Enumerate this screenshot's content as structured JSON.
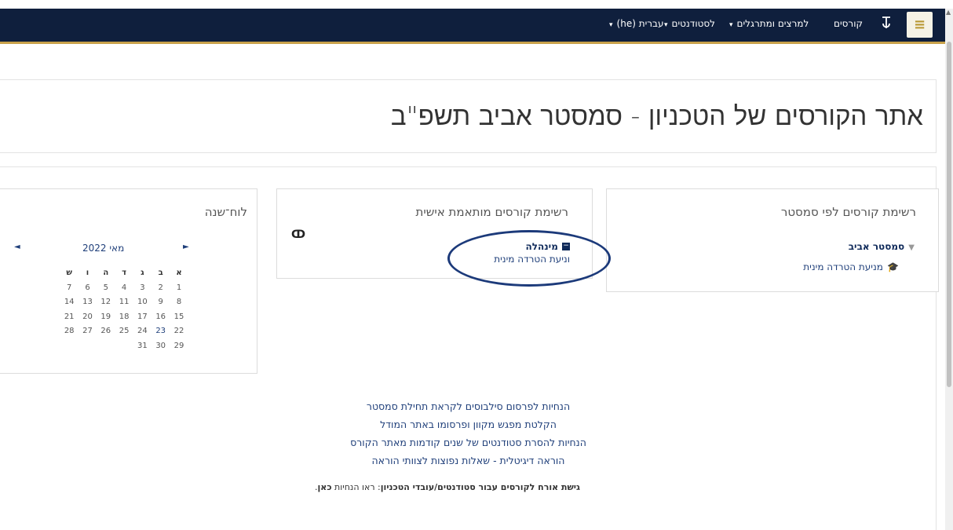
{
  "navbar": {
    "menu_icon": "hamburger-icon",
    "logo_icon": "technion-logo-icon",
    "links": [
      {
        "label": "קורסים"
      },
      {
        "label": "למרצים ומתרגלים",
        "caret": "▾"
      },
      {
        "label": "לסטודנטים",
        "caret": "▾"
      },
      {
        "label": "עברית (he)",
        "caret": "▾"
      }
    ]
  },
  "header": {
    "title": "אתר הקורסים של הטכניון - סמסטר אביב תשפ\"ב"
  },
  "blocks": {
    "semester_courses": {
      "title": "רשימת קורסים לפי סמסטר",
      "semester_label": "סמסטר אביב",
      "course_label": "מניעת הטרדה מינית",
      "course_icon": "graduation-cap-icon",
      "caret_icon": "caret-down-icon"
    },
    "personal_courses": {
      "title": "רשימת קורסים מותאמת אישית",
      "toggle_icon": "toggle-icon",
      "category_label": "מינהלה",
      "category_icon": "minus-box-icon",
      "course_label": "וניעת הטרדה מינית"
    },
    "calendar": {
      "title": "לוח־שנה",
      "month_label": "מאי 2022",
      "prev_icon": "arrow-left-icon",
      "next_icon": "arrow-right-icon",
      "weekdays": [
        "א",
        "ב",
        "ג",
        "ד",
        "ה",
        "ו",
        "ש"
      ],
      "weeks": [
        [
          "1",
          "2",
          "3",
          "4",
          "5",
          "6",
          "7"
        ],
        [
          "8",
          "9",
          "10",
          "11",
          "12",
          "13",
          "14"
        ],
        [
          "15",
          "16",
          "17",
          "18",
          "19",
          "20",
          "21"
        ],
        [
          "22",
          "23",
          "24",
          "25",
          "26",
          "27",
          "28"
        ],
        [
          "29",
          "30",
          "31",
          "",
          "",
          "",
          ""
        ]
      ],
      "today": "23"
    }
  },
  "center_links": [
    "הנחיות לפרסום סילבוסים לקראת תחילת סמסטר",
    "הקלטת מפגש מקוון ופרסומו באתר המודל",
    "הנחיות להסרת סטודנטים של שנים קודמות מאתר הקורס",
    "הוראה דיגיטלית - שאלות נפוצות לצוותי הוראה"
  ],
  "guest": {
    "bold_text": "גישת אורח לקורסים עבור סטודנטים/עובדי הטכניון",
    "plain_text": ": ראו הנחיות ",
    "link_text": "כאן",
    "end": "."
  },
  "colors": {
    "navbar": "#0f1f3d",
    "accent": "#c8a14a",
    "link": "#1f3f7a",
    "annotation": "#1c3a7a"
  }
}
